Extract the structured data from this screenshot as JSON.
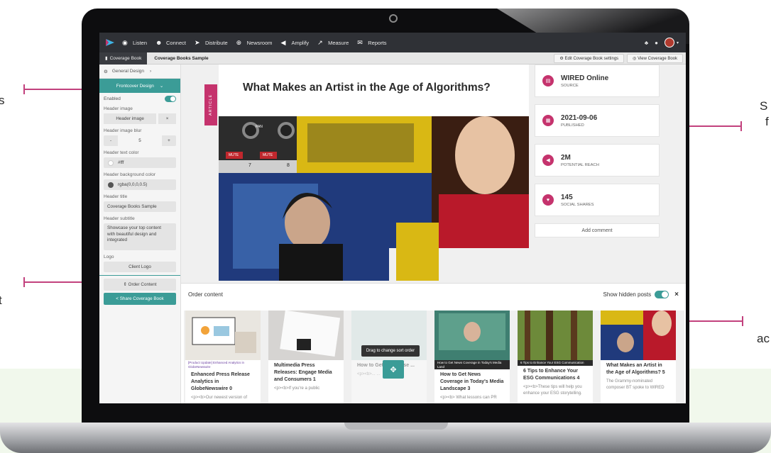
{
  "callouts": {
    "left_top": "s",
    "right_top_line1": "S",
    "right_top_line2": "f",
    "left_bottom": "t",
    "right_bottom": "ac"
  },
  "nav": {
    "items": [
      {
        "label": "Listen",
        "icon": "binoculars-icon"
      },
      {
        "label": "Connect",
        "icon": "people-icon"
      },
      {
        "label": "Distribute",
        "icon": "paper-plane-icon"
      },
      {
        "label": "Newsroom",
        "icon": "globe-icon"
      },
      {
        "label": "Amplify",
        "icon": "megaphone-icon"
      },
      {
        "label": "Measure",
        "icon": "chart-icon"
      },
      {
        "label": "Reports",
        "icon": "envelope-icon"
      }
    ],
    "bell_icon": "bell-icon",
    "help_icon": "question-icon",
    "avatar": "user-avatar"
  },
  "breadcrumb": {
    "root": "Coverage Book",
    "current": "Coverage Books Sample",
    "edit_settings": "Edit Coverage Book settings",
    "view_book": "View Coverage Book"
  },
  "sidebar": {
    "general_design": "General Design",
    "frontcover_design": "Frontcover Design",
    "enabled_label": "Enabled",
    "enabled": true,
    "header_image_label": "Header image",
    "header_image_button": "Header image",
    "header_image_clear": "×",
    "blur_label": "Header image blur",
    "blur_minus": "-",
    "blur_value": "5",
    "blur_plus": "+",
    "text_color_label": "Header text color",
    "text_color_value": "#fff",
    "bg_color_label": "Header background color",
    "bg_color_value": "rgba(0,0,0,0.5)",
    "title_label": "Header title",
    "title_value": "Coverage Books Sample",
    "subtitle_label": "Header subtitle",
    "subtitle_value": "Showcase your top content with beautiful design and integrated",
    "logo_label": "Logo",
    "logo_button": "Client Logo",
    "order_button": "⇕ Order Content",
    "share_button": "< Share Coverage Book"
  },
  "article": {
    "tag": "ARTICLE",
    "headline": "What Makes an Artist in the Age of Algorithms?",
    "mixer_labels": [
      "PAN",
      "MUTE",
      "MUTE",
      "7",
      "8"
    ]
  },
  "meta": [
    {
      "value": "WIRED Online",
      "label": "SOURCE",
      "icon": "newspaper-icon"
    },
    {
      "value": "2021-09-06",
      "label": "PUBLISHED",
      "icon": "calendar-icon"
    },
    {
      "value": "2M",
      "label": "POTENTIAL REACH",
      "icon": "megaphone-icon"
    },
    {
      "value": "145",
      "label": "SOCIAL SHARES",
      "icon": "heart-icon"
    }
  ],
  "add_comment": "Add comment",
  "order": {
    "title": "Order content",
    "show_hidden": "Show hidden posts",
    "close": "×",
    "drag_tip": "Drag to change sort order",
    "tiles": [
      {
        "tag": "[Product Update] Enhanced Analytics in GlobeNewswire",
        "title": "Enhanced Press Release Analytics in GlobeNewswire 0",
        "text": "<p><b>Our newest version of"
      },
      {
        "tag": "",
        "title": "Multimedia Press Releases: Engage Media and Consumers 1",
        "text": "<p><b>If you're a public"
      },
      {
        "tag": "",
        "title": "How to Get ... Release ...",
        "text": "<p><b>... ..."
      },
      {
        "tag": "How to Get News Coverage in Today's Media Land",
        "title": "How to Get News Coverage in Today's Media Landscape 3",
        "text": "<p><b> What lessons can PR"
      },
      {
        "tag": "6 Tips to Enhance Your ESG Communication",
        "title": "6 Tips to Enhance Your ESG Communications 4",
        "text": "<p><b>These tips will help you enhance your ESG storytelling."
      },
      {
        "tag": "",
        "title": "What Makes an Artist in the Age of Algorithms? 5",
        "text": "The Grammy-nominated composer BT spoke to WIRED"
      }
    ]
  },
  "colors": {
    "accent": "#3b9c97",
    "pink": "#c5336d",
    "nav_bg": "#2f3136",
    "callout": "#c2417d"
  }
}
